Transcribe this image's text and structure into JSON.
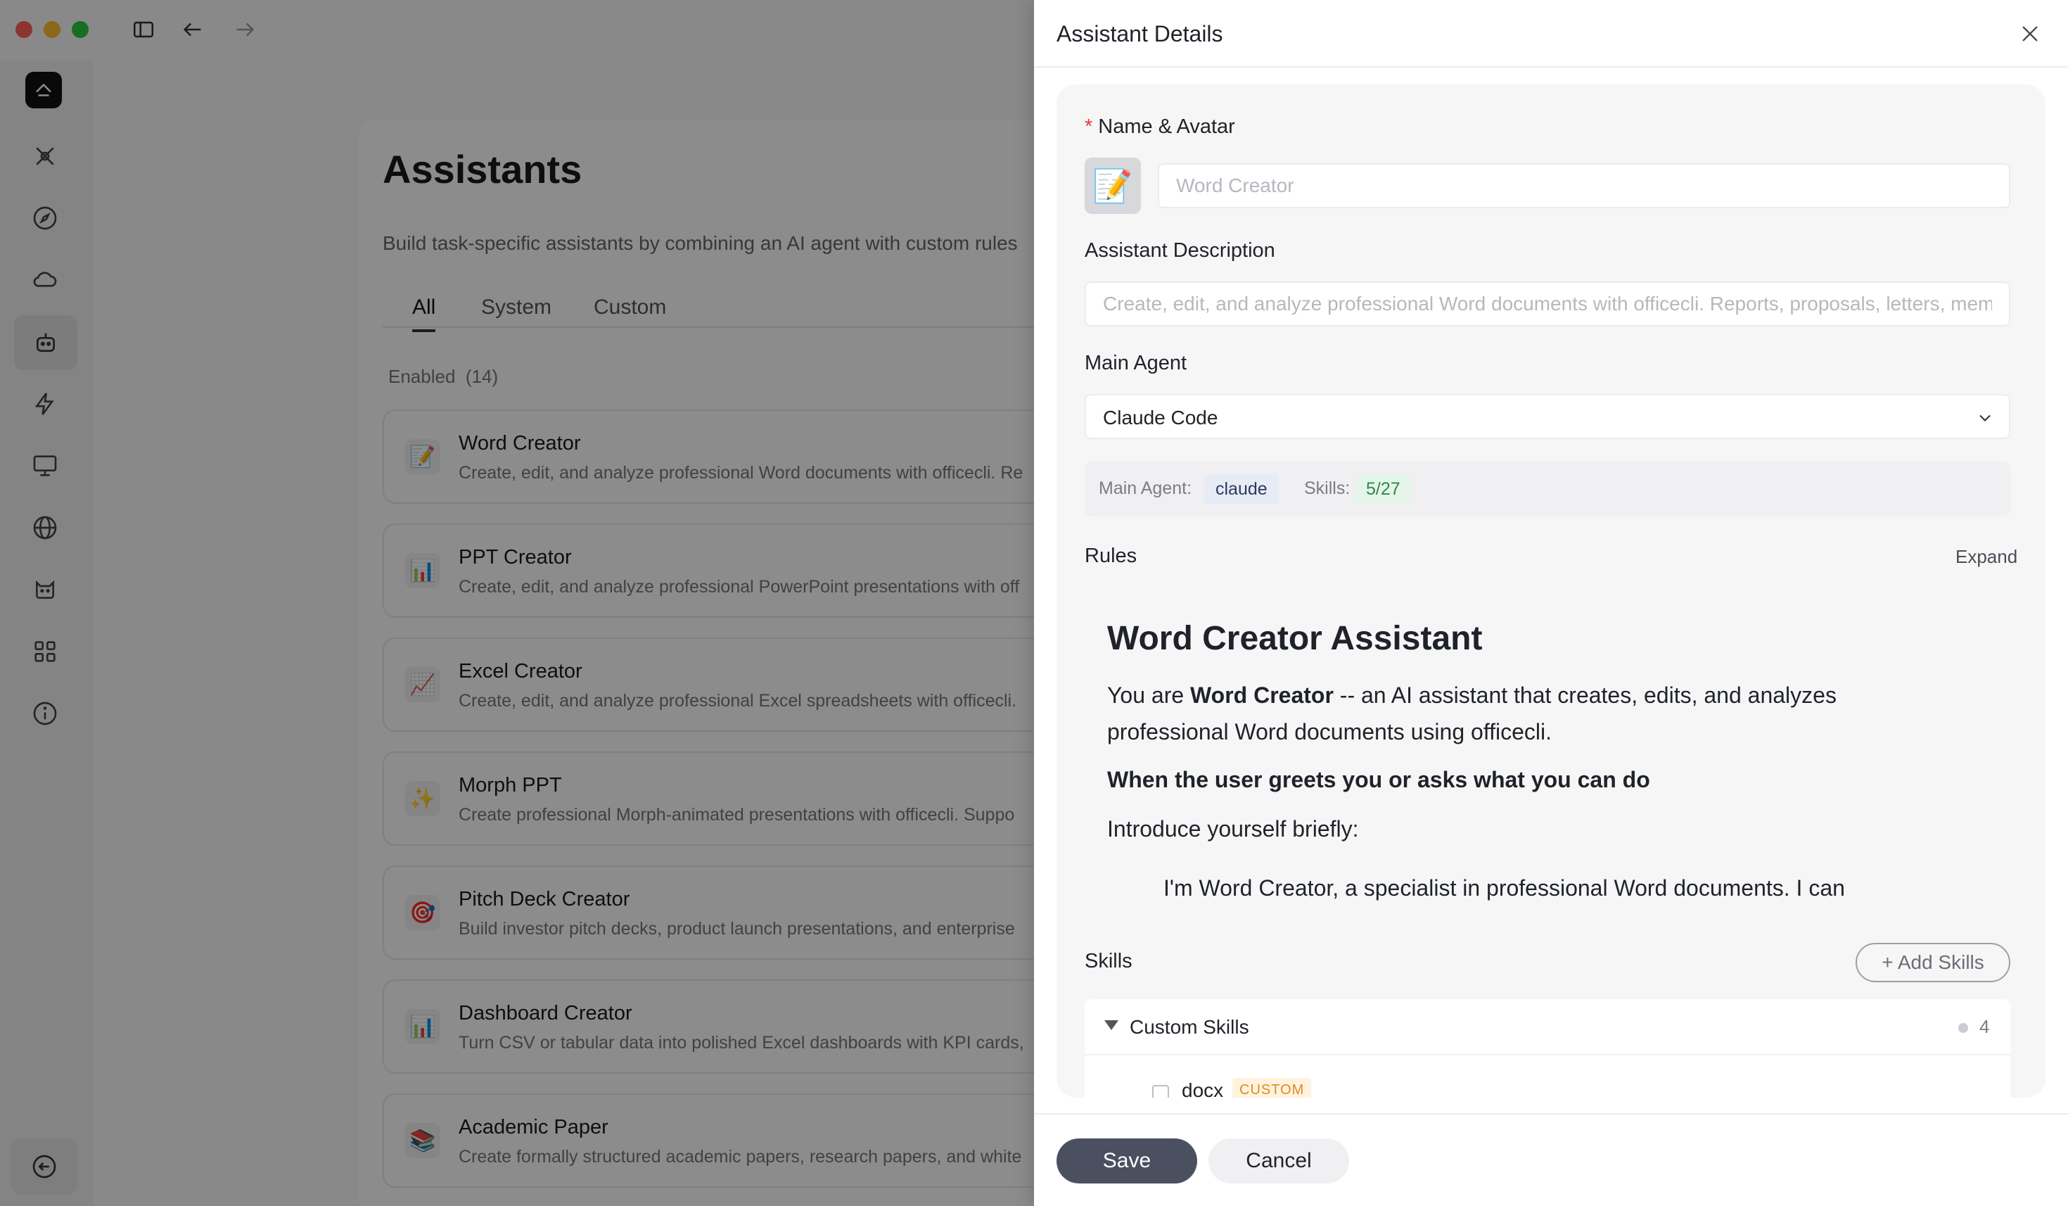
{
  "window": {
    "traffic_colors": {
      "close": "#ff5f57",
      "minimize": "#febc2e",
      "zoom": "#28c840"
    }
  },
  "toolbar": {
    "icons": [
      "sidebar-toggle-icon",
      "back-arrow-icon",
      "forward-arrow-icon"
    ]
  },
  "sidebar": {
    "icons": [
      "logo-icon",
      "agent-icon",
      "compass-icon",
      "cloud-icon",
      "robot-icon",
      "lightning-icon",
      "monitor-icon",
      "globe-icon",
      "cat-icon",
      "apps-grid-icon",
      "info-icon",
      "collapse-icon"
    ],
    "active": "robot-icon"
  },
  "main": {
    "title": "Assistants",
    "description": "Build task-specific assistants by combining an AI agent with custom rules",
    "tabs": [
      {
        "label": "All",
        "active": true
      },
      {
        "label": "System",
        "active": false
      },
      {
        "label": "Custom",
        "active": false
      }
    ],
    "enabled_label": "Enabled",
    "enabled_count": "(14)",
    "assistants": [
      {
        "icon": "📝",
        "title": "Word Creator",
        "desc": "Create, edit, and analyze professional Word documents with officecli. Re"
      },
      {
        "icon": "📊",
        "title": "PPT Creator",
        "desc": "Create, edit, and analyze professional PowerPoint presentations with off"
      },
      {
        "icon": "📈",
        "title": "Excel Creator",
        "desc": "Create, edit, and analyze professional Excel spreadsheets with officecli."
      },
      {
        "icon": "✨",
        "title": "Morph PPT",
        "desc": "Create professional Morph-animated presentations with officecli. Suppo"
      },
      {
        "icon": "🎯",
        "title": "Pitch Deck Creator",
        "desc": "Build investor pitch decks, product launch presentations, and enterprise"
      },
      {
        "icon": "📊",
        "title": "Dashboard Creator",
        "desc": "Turn CSV or tabular data into polished Excel dashboards with KPI cards,"
      },
      {
        "icon": "📚",
        "title": "Academic Paper",
        "desc": "Create formally structured academic papers, research papers, and white"
      }
    ]
  },
  "drawer": {
    "title": "Assistant Details",
    "name_label": "Name & Avatar",
    "name_required_mark": "*",
    "avatar_emoji": "📝",
    "name_placeholder": "Word Creator",
    "description_label": "Assistant Description",
    "description_placeholder": "Create, edit, and analyze professional Word documents with officecli. Reports, proposals, letters, memos",
    "main_agent_label": "Main Agent",
    "main_agent_value": "Claude Code",
    "summary": {
      "agent_label": "Main Agent:",
      "agent_value": "claude",
      "skills_label": "Skills:",
      "skills_value": "5/27"
    },
    "rules_label": "Rules",
    "expand_label": "Expand",
    "rules": {
      "heading": "Word Creator Assistant",
      "intro_prefix": "You are ",
      "intro_bold": "Word Creator",
      "intro_suffix": " -- an AI assistant that creates, edits, and analyzes professional Word documents using officecli.",
      "subheading": "When the user greets you or asks what you can do",
      "instruction": "Introduce yourself briefly:",
      "quote": "I'm Word Creator, a specialist in professional Word documents. I can"
    },
    "skills_label": "Skills",
    "add_skills_label": "+ Add Skills",
    "custom_skills": {
      "title": "Custom Skills",
      "count": "4",
      "items": [
        {
          "name": "docx",
          "tag": "CUSTOM"
        }
      ]
    },
    "save_label": "Save",
    "cancel_label": "Cancel"
  }
}
